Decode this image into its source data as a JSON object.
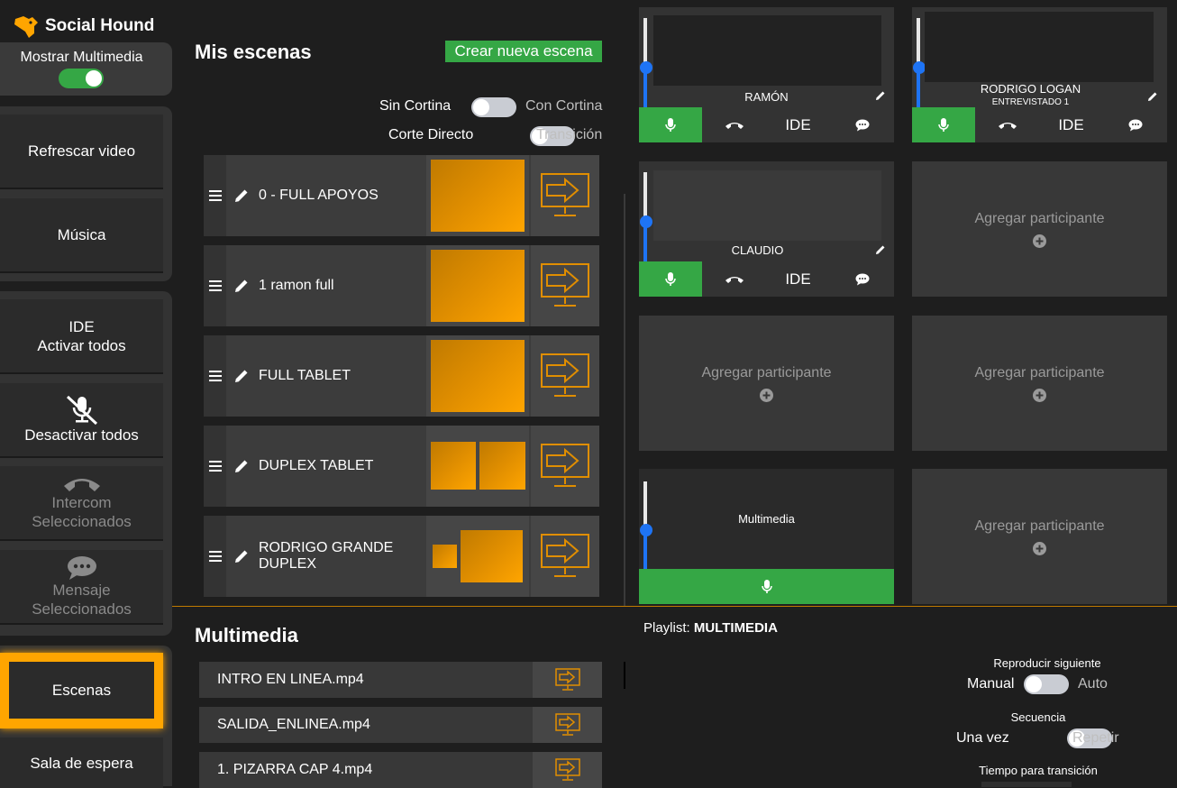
{
  "app": {
    "brand": "Social Hound",
    "accent": "#ffa500",
    "green": "#35a745"
  },
  "sidebar": {
    "show_media_label": "Mostrar Multimedia",
    "show_media_on": true,
    "refresh": "Refrescar video",
    "music": "Música",
    "ide_line1": "IDE",
    "ide_line2": "Activar todos",
    "deactivate": "Desactivar todos",
    "intercom_line1": "Intercom",
    "intercom_line2": "Seleccionados",
    "message_line1": "Mensaje",
    "message_line2": "Seleccionados",
    "scenes": "Escenas",
    "waiting": "Sala de espera"
  },
  "scenes": {
    "title": "Mis escenas",
    "create": "Crear nueva escena",
    "curtain_off": "Sin Cortina",
    "curtain_on": "Con Cortina",
    "cut_off": "Corte Directo",
    "cut_on": "Transición",
    "items": [
      {
        "name": "0 - FULL APOYOS"
      },
      {
        "name": "1 ramon full"
      },
      {
        "name": "FULL TABLET"
      },
      {
        "name": "DUPLEX TABLET"
      },
      {
        "name": "RODRIGO GRANDE DUPLEX"
      }
    ]
  },
  "participants": {
    "p1": {
      "name": "RAMÓN",
      "sub": "",
      "ide": "IDE",
      "volume": 0.55
    },
    "p2": {
      "name": "RODRIGO LOGAN",
      "sub": "ENTREVISTADO 1",
      "ide": "IDE",
      "volume": 0.55
    },
    "p3": {
      "name": "CLAUDIO",
      "sub": "",
      "ide": "IDE",
      "volume": 0.55
    },
    "media": {
      "name": "Multimedia",
      "volume": 0.55
    },
    "add_label": "Agregar participante"
  },
  "multimedia": {
    "title": "Multimedia",
    "files": [
      "INTRO EN LINEA.mp4",
      "SALIDA_ENLINEA.mp4",
      "1. PIZARRA CAP 4.mp4"
    ]
  },
  "playlist": {
    "label": "Playlist:",
    "name": "MULTIMEDIA",
    "next_title": "Reproducir siguiente",
    "next_off": "Manual",
    "next_on": "Auto",
    "seq_title": "Secuencia",
    "seq_off": "Una vez",
    "seq_on": "Repetir",
    "transition_title": "Tiempo para transición"
  }
}
